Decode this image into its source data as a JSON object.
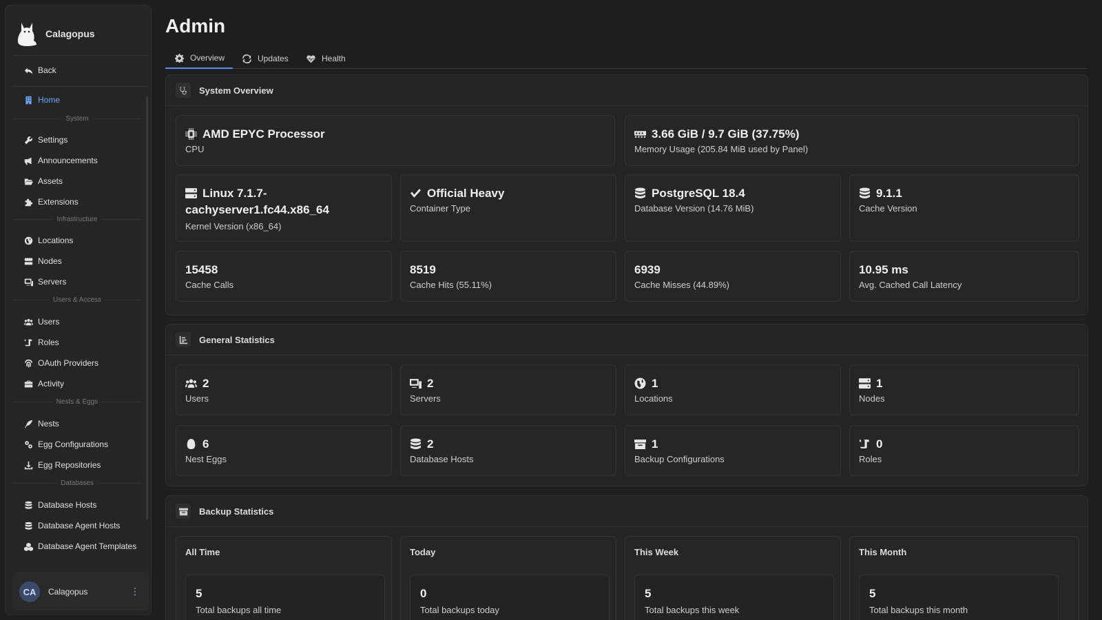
{
  "brand": {
    "name": "Calagopus"
  },
  "sidebar": {
    "back": "Back",
    "home": "Home",
    "sections": {
      "system": "System",
      "infrastructure": "Infrastructure",
      "users_access": "Users & Access",
      "nests_eggs": "Nests & Eggs",
      "databases": "Databases"
    },
    "items": {
      "settings": "Settings",
      "announcements": "Announcements",
      "assets": "Assets",
      "extensions": "Extensions",
      "locations": "Locations",
      "nodes": "Nodes",
      "servers": "Servers",
      "users": "Users",
      "roles": "Roles",
      "oauth": "OAuth Providers",
      "activity": "Activity",
      "nests": "Nests",
      "egg_configs": "Egg Configurations",
      "egg_repos": "Egg Repositories",
      "db_hosts": "Database Hosts",
      "db_agent_hosts": "Database Agent Hosts",
      "db_agent_templates": "Database Agent Templates"
    },
    "user": {
      "initials": "CA",
      "name": "Calagopus"
    }
  },
  "page": {
    "title": "Admin"
  },
  "tabs": {
    "overview": "Overview",
    "updates": "Updates",
    "health": "Health"
  },
  "system_overview": {
    "title": "System Overview",
    "cpu": {
      "value": "AMD EPYC Processor",
      "label": "CPU"
    },
    "memory": {
      "value": "3.66 GiB / 9.7 GiB (37.75%)",
      "label": "Memory Usage (205.84 MiB used by Panel)"
    },
    "kernel": {
      "value_line1": "Linux 7.1.7-",
      "value_line2": "cachyserver1.fc44.x86_64",
      "label": "Kernel Version (x86_64)"
    },
    "container": {
      "value": "Official Heavy",
      "label": "Container Type"
    },
    "database": {
      "value": "PostgreSQL 18.4",
      "label": "Database Version (14.76 MiB)"
    },
    "cache": {
      "value": "9.1.1",
      "label": "Cache Version"
    },
    "cache_calls": {
      "value": "15458",
      "label": "Cache Calls"
    },
    "cache_hits": {
      "value": "8519",
      "label": "Cache Hits (55.11%)"
    },
    "cache_misses": {
      "value": "6939",
      "label": "Cache Misses (44.89%)"
    },
    "latency": {
      "value": "10.95 ms",
      "label": "Avg. Cached Call Latency"
    }
  },
  "general_statistics": {
    "title": "General Statistics",
    "users": {
      "value": "2",
      "label": "Users"
    },
    "servers": {
      "value": "2",
      "label": "Servers"
    },
    "locations": {
      "value": "1",
      "label": "Locations"
    },
    "nodes": {
      "value": "1",
      "label": "Nodes"
    },
    "nest_eggs": {
      "value": "6",
      "label": "Nest Eggs"
    },
    "db_hosts": {
      "value": "2",
      "label": "Database Hosts"
    },
    "backup_configs": {
      "value": "1",
      "label": "Backup Configurations"
    },
    "roles": {
      "value": "0",
      "label": "Roles"
    }
  },
  "backup_statistics": {
    "title": "Backup Statistics",
    "all_time": {
      "title": "All Time",
      "value": "5",
      "label": "Total backups all time"
    },
    "today": {
      "title": "Today",
      "value": "0",
      "label": "Total backups today"
    },
    "week": {
      "title": "This Week",
      "value": "5",
      "label": "Total backups this week"
    },
    "month": {
      "title": "This Month",
      "value": "5",
      "label": "Total backups this month"
    }
  }
}
